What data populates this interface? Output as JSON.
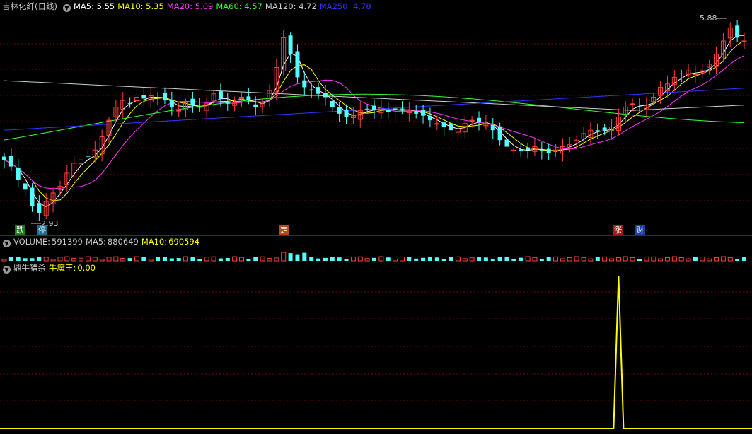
{
  "main": {
    "title": "吉林化纤(日线)",
    "indicators": [
      {
        "label": "MA5:",
        "value": "5.55",
        "color": "#ffffff"
      },
      {
        "label": "MA10:",
        "value": "5.35",
        "color": "#ffff00"
      },
      {
        "label": "MA20:",
        "value": "5.09",
        "color": "#ff33ff"
      },
      {
        "label": "MA60:",
        "value": "4.57",
        "color": "#33ff33"
      },
      {
        "label": "MA120:",
        "value": "4.72",
        "color": "#cccccc"
      },
      {
        "label": "MA250:",
        "value": "4.78",
        "color": "#3333ff"
      }
    ],
    "high_label": "5.88",
    "low_label": "2.93",
    "flags": [
      {
        "text": "跌",
        "color": "#1a7f1a"
      },
      {
        "text": "停",
        "color": "#1a6f8f"
      },
      {
        "text": "定",
        "color": "#b34a1a"
      },
      {
        "text": "涨",
        "color": "#a01a1a"
      },
      {
        "text": "财",
        "color": "#1a3fa0"
      }
    ]
  },
  "volume": {
    "label": "VOLUME:",
    "value": "591399",
    "ma5_label": "MA5:",
    "ma5_value": "880649",
    "ma10_label": "MA10:",
    "ma10_value": "690594"
  },
  "indicator_panel": {
    "name": "鼎牛猎杀",
    "series_label": "牛魔王:",
    "series_value": "0.00"
  },
  "colors": {
    "up": "#ff4040",
    "down": "#54ffff",
    "grid": "#7a0000",
    "signal": "#ffff00"
  },
  "chart_data": {
    "type": "candlestick",
    "ohlc_approx_close": [
      3.75,
      3.65,
      3.45,
      3.3,
      3.05,
      2.95,
      3.12,
      3.25,
      3.35,
      3.55,
      3.7,
      3.75,
      3.8,
      3.9,
      4.1,
      4.35,
      4.55,
      4.65,
      4.6,
      4.7,
      4.68,
      4.72,
      4.7,
      4.65,
      4.55,
      4.5,
      4.62,
      4.58,
      4.55,
      4.6,
      4.75,
      4.68,
      4.6,
      4.62,
      4.7,
      4.65,
      4.55,
      4.6,
      4.8,
      5.15,
      5.6,
      5.35,
      5.0,
      4.85,
      4.8,
      4.75,
      4.7,
      4.55,
      4.45,
      4.4,
      4.42,
      4.5,
      4.52,
      4.5,
      4.55,
      4.48,
      4.5,
      4.52,
      4.5,
      4.45,
      4.42,
      4.35,
      4.3,
      4.25,
      4.2,
      4.22,
      4.3,
      4.35,
      4.32,
      4.3,
      4.2,
      4.05,
      3.95,
      3.9,
      3.88,
      3.9,
      3.95,
      3.88,
      3.85,
      3.9,
      3.95,
      3.98,
      4.05,
      4.15,
      4.2,
      4.18,
      4.2,
      4.25,
      4.4,
      4.55,
      4.6,
      4.55,
      4.58,
      4.7,
      4.85,
      4.9,
      5.0,
      5.05,
      5.1,
      5.05,
      5.1,
      5.2,
      5.35,
      5.55,
      5.75,
      5.6,
      5.55
    ],
    "high": 5.88,
    "low": 2.93,
    "signal_spike_index": 88,
    "signal_values": "0 except a single spike near the right side"
  }
}
